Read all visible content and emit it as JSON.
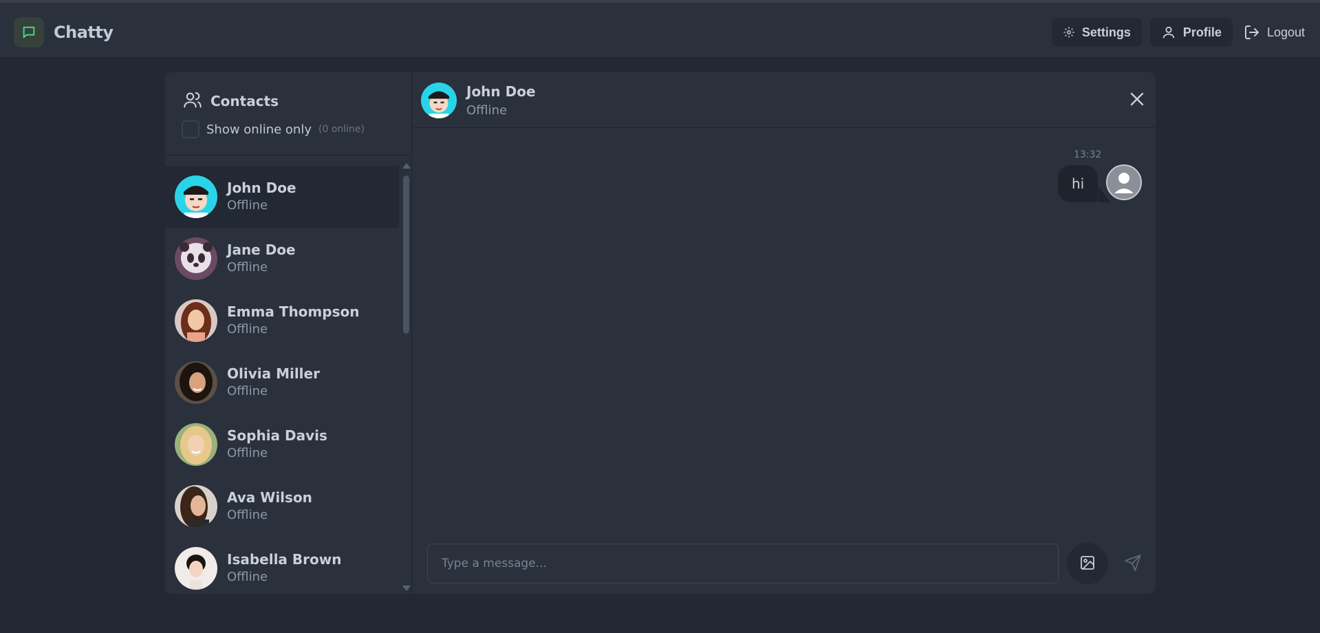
{
  "app": {
    "name": "Chatty",
    "icon": "message-square-icon"
  },
  "nav": {
    "settings": {
      "label": "Settings",
      "icon": "gear-icon"
    },
    "profile": {
      "label": "Profile",
      "icon": "user-icon"
    },
    "logout": {
      "label": "Logout",
      "icon": "logout-icon"
    }
  },
  "sidebar": {
    "title": "Contacts",
    "icon": "users-icon",
    "filter_label": "Show online only",
    "online_count": "(0 online)",
    "filter_checked": false,
    "contacts": [
      {
        "name": "John Doe",
        "status": "Offline",
        "active": true
      },
      {
        "name": "Jane Doe",
        "status": "Offline",
        "active": false
      },
      {
        "name": "Emma Thompson",
        "status": "Offline",
        "active": false
      },
      {
        "name": "Olivia Miller",
        "status": "Offline",
        "active": false
      },
      {
        "name": "Sophia Davis",
        "status": "Offline",
        "active": false
      },
      {
        "name": "Ava Wilson",
        "status": "Offline",
        "active": false
      },
      {
        "name": "Isabella Brown",
        "status": "Offline",
        "active": false
      }
    ]
  },
  "chat": {
    "name": "John Doe",
    "status": "Offline",
    "messages": [
      {
        "time": "13:32",
        "text": "hi",
        "from": "me"
      }
    ],
    "input_placeholder": "Type a message...",
    "input_value": ""
  },
  "colors": {
    "background": "#222834",
    "surface": "#2a303c",
    "text": "#c9d0dc",
    "muted": "#8f97a6",
    "brand_icon": "#4ade80"
  }
}
